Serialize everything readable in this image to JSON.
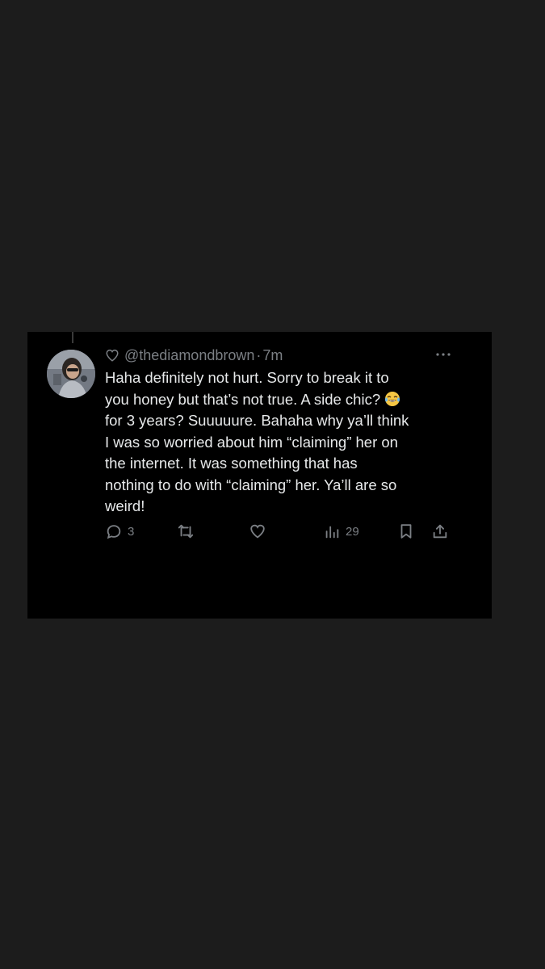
{
  "tweet": {
    "handle": "@thediamondbrown",
    "separator": "·",
    "time": "7m",
    "text_part1": "Haha definitely not hurt. Sorry to break it to\nyou honey but that’s not true. A side chic? ",
    "text_part2": "\nfor 3 years? Suuuuure. Bahaha why ya’ll think\nI was so worried about him “claiming” her on\nthe internet. It was something that has\nnothing to do with “claiming” her. Ya’ll are so\nweird!",
    "emoji": "laughing-crying-emoji",
    "reply_count": "3",
    "views_count": "29"
  },
  "icons": {
    "header_heart": "heart-outline-icon",
    "more": "more-dots-icon",
    "reply": "reply-icon",
    "retweet": "retweet-icon",
    "like": "like-icon",
    "views": "views-icon",
    "bookmark": "bookmark-icon",
    "share": "share-icon"
  },
  "colors": {
    "page_background": "#1c1c1c",
    "card_background": "#000000",
    "text_primary": "#e7e9ea",
    "text_secondary": "#7b7f84"
  }
}
